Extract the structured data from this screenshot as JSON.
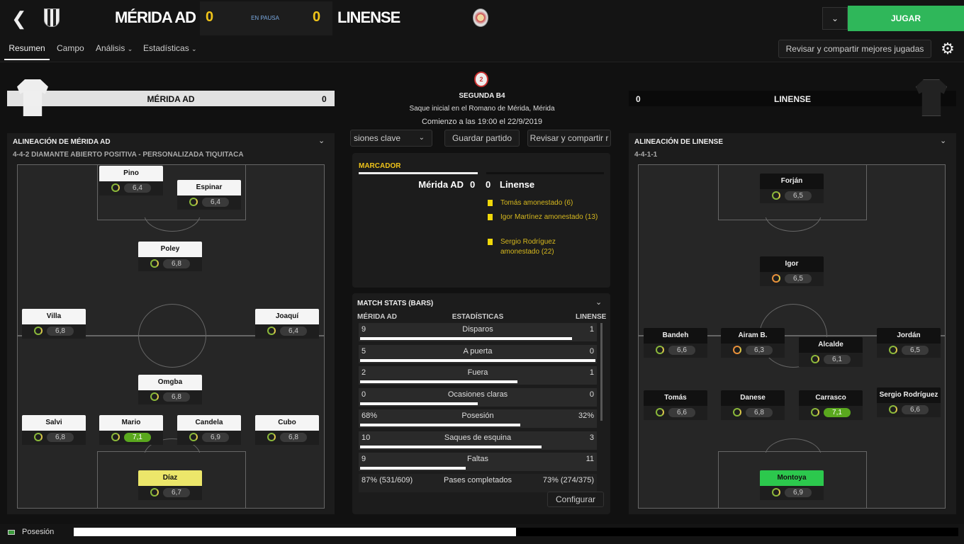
{
  "header": {
    "home_team": "MÉRIDA AD",
    "home_score": "0",
    "status": "EN PAUSA",
    "away_score": "0",
    "away_team": "LINENSE",
    "play_label": "JUGAR"
  },
  "nav": {
    "tabs": [
      "Resumen",
      "Campo",
      "Análisis",
      "Estadísticas"
    ],
    "share_label": "Revisar y compartir mejores jugadas"
  },
  "home_bar": {
    "name": "MÉRIDA AD",
    "score": "0"
  },
  "away_bar": {
    "name": "LINENSE",
    "score": "0"
  },
  "match": {
    "competition": "SEGUNDA B4",
    "venue": "Saque inicial en el Romano de Mérida, Mérida",
    "kickoff": "Comienzo a las 19:00 el 22/9/2019"
  },
  "actions": {
    "key": "siones clave",
    "save": "Guardar partido",
    "share": "Revisar y compartir r"
  },
  "scoreboard": {
    "title": "MARCADOR",
    "home": "Mérida AD",
    "hs": "0",
    "as": "0",
    "away": "Linense",
    "events": [
      {
        "text": "Tomás amonestado (6)"
      },
      {
        "text": "Igor Martínez amonestado (13)"
      },
      {
        "text": "Sergio Rodríguez amonestado (22)"
      }
    ]
  },
  "home_lineup": {
    "title": "ALINEACIÓN DE MÉRIDA AD",
    "formation": "4-4-2 DIAMANTE ABIERTO POSITIVA - PERSONALIZADA TIQUITACA",
    "players": [
      {
        "name": "Pino",
        "rating": "6,4"
      },
      {
        "name": "Espinar",
        "rating": "6,4"
      },
      {
        "name": "Poley",
        "rating": "6,8"
      },
      {
        "name": "Villa",
        "rating": "6,8"
      },
      {
        "name": "Joaquí",
        "rating": "6,4"
      },
      {
        "name": "Omgba",
        "rating": "6,8"
      },
      {
        "name": "Salvi",
        "rating": "6,8"
      },
      {
        "name": "Mario",
        "rating": "7,1"
      },
      {
        "name": "Candela",
        "rating": "6,9"
      },
      {
        "name": "Cubo",
        "rating": "6,8"
      },
      {
        "name": "Díaz",
        "rating": "6,7"
      }
    ]
  },
  "away_lineup": {
    "title": "ALINEACIÓN DE LINENSE",
    "formation": "4-4-1-1",
    "players": [
      {
        "name": "Forján",
        "rating": "6,5"
      },
      {
        "name": "Igor",
        "rating": "6,5"
      },
      {
        "name": "Bandeh",
        "rating": "6,6"
      },
      {
        "name": "Airam B.",
        "rating": "6,3"
      },
      {
        "name": "Alcalde",
        "rating": "6,1"
      },
      {
        "name": "Jordán",
        "rating": "6,5"
      },
      {
        "name": "Tomás",
        "rating": "6,6"
      },
      {
        "name": "Danese",
        "rating": "6,8"
      },
      {
        "name": "Carrasco",
        "rating": "7,1"
      },
      {
        "name": "Sergio Rodríguez",
        "rating": "6,6"
      },
      {
        "name": "Montoya",
        "rating": "6,9"
      }
    ]
  },
  "stats": {
    "title": "MATCH STATS (BARS)",
    "home": "MÉRIDA AD",
    "mid": "ESTADÍSTICAS",
    "away": "LINENSE",
    "rows": [
      {
        "h": "9",
        "label": "Disparos",
        "a": "1",
        "frac": 0.9
      },
      {
        "h": "5",
        "label": "A puerta",
        "a": "0",
        "frac": 1.0
      },
      {
        "h": "2",
        "label": "Fuera",
        "a": "1",
        "frac": 0.67
      },
      {
        "h": "0",
        "label": "Ocasiones claras",
        "a": "0",
        "frac": 0.5
      },
      {
        "h": "68%",
        "label": "Posesión",
        "a": "32%",
        "frac": 0.68
      },
      {
        "h": "10",
        "label": "Saques de esquina",
        "a": "3",
        "frac": 0.77
      },
      {
        "h": "9",
        "label": "Faltas",
        "a": "11",
        "frac": 0.45
      }
    ],
    "pass": {
      "h": "87% (531/609)",
      "label": "Pases completados",
      "a": "73% (274/375)"
    },
    "configure": "Configurar"
  },
  "possession": {
    "label": "Posesión",
    "home_frac": 0.5
  }
}
